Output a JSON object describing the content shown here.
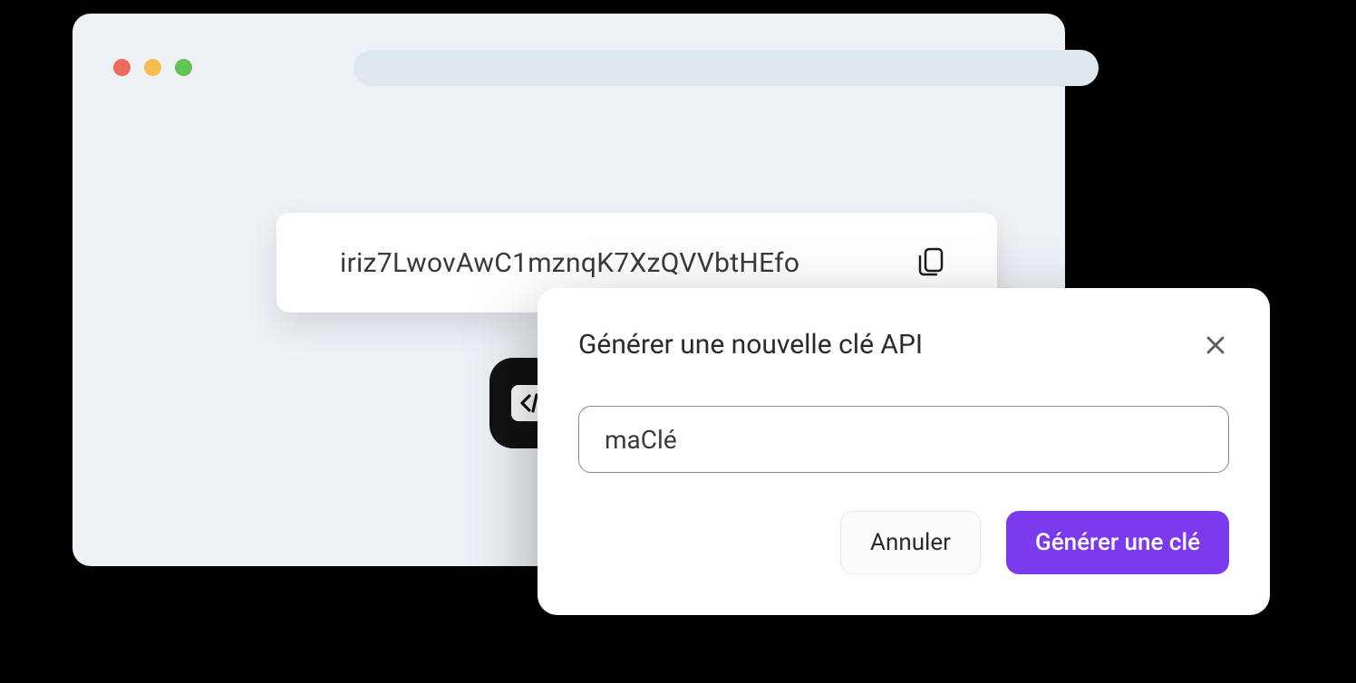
{
  "api_key": {
    "value": "iriz7LwovAwC1mznqK7XzQVVbtHEfo"
  },
  "dialog": {
    "title": "Générer une nouvelle clé API",
    "input_value": "maClé",
    "cancel_label": "Annuler",
    "generate_label": "Générer une clé"
  },
  "colors": {
    "primary": "#7c3aed"
  }
}
